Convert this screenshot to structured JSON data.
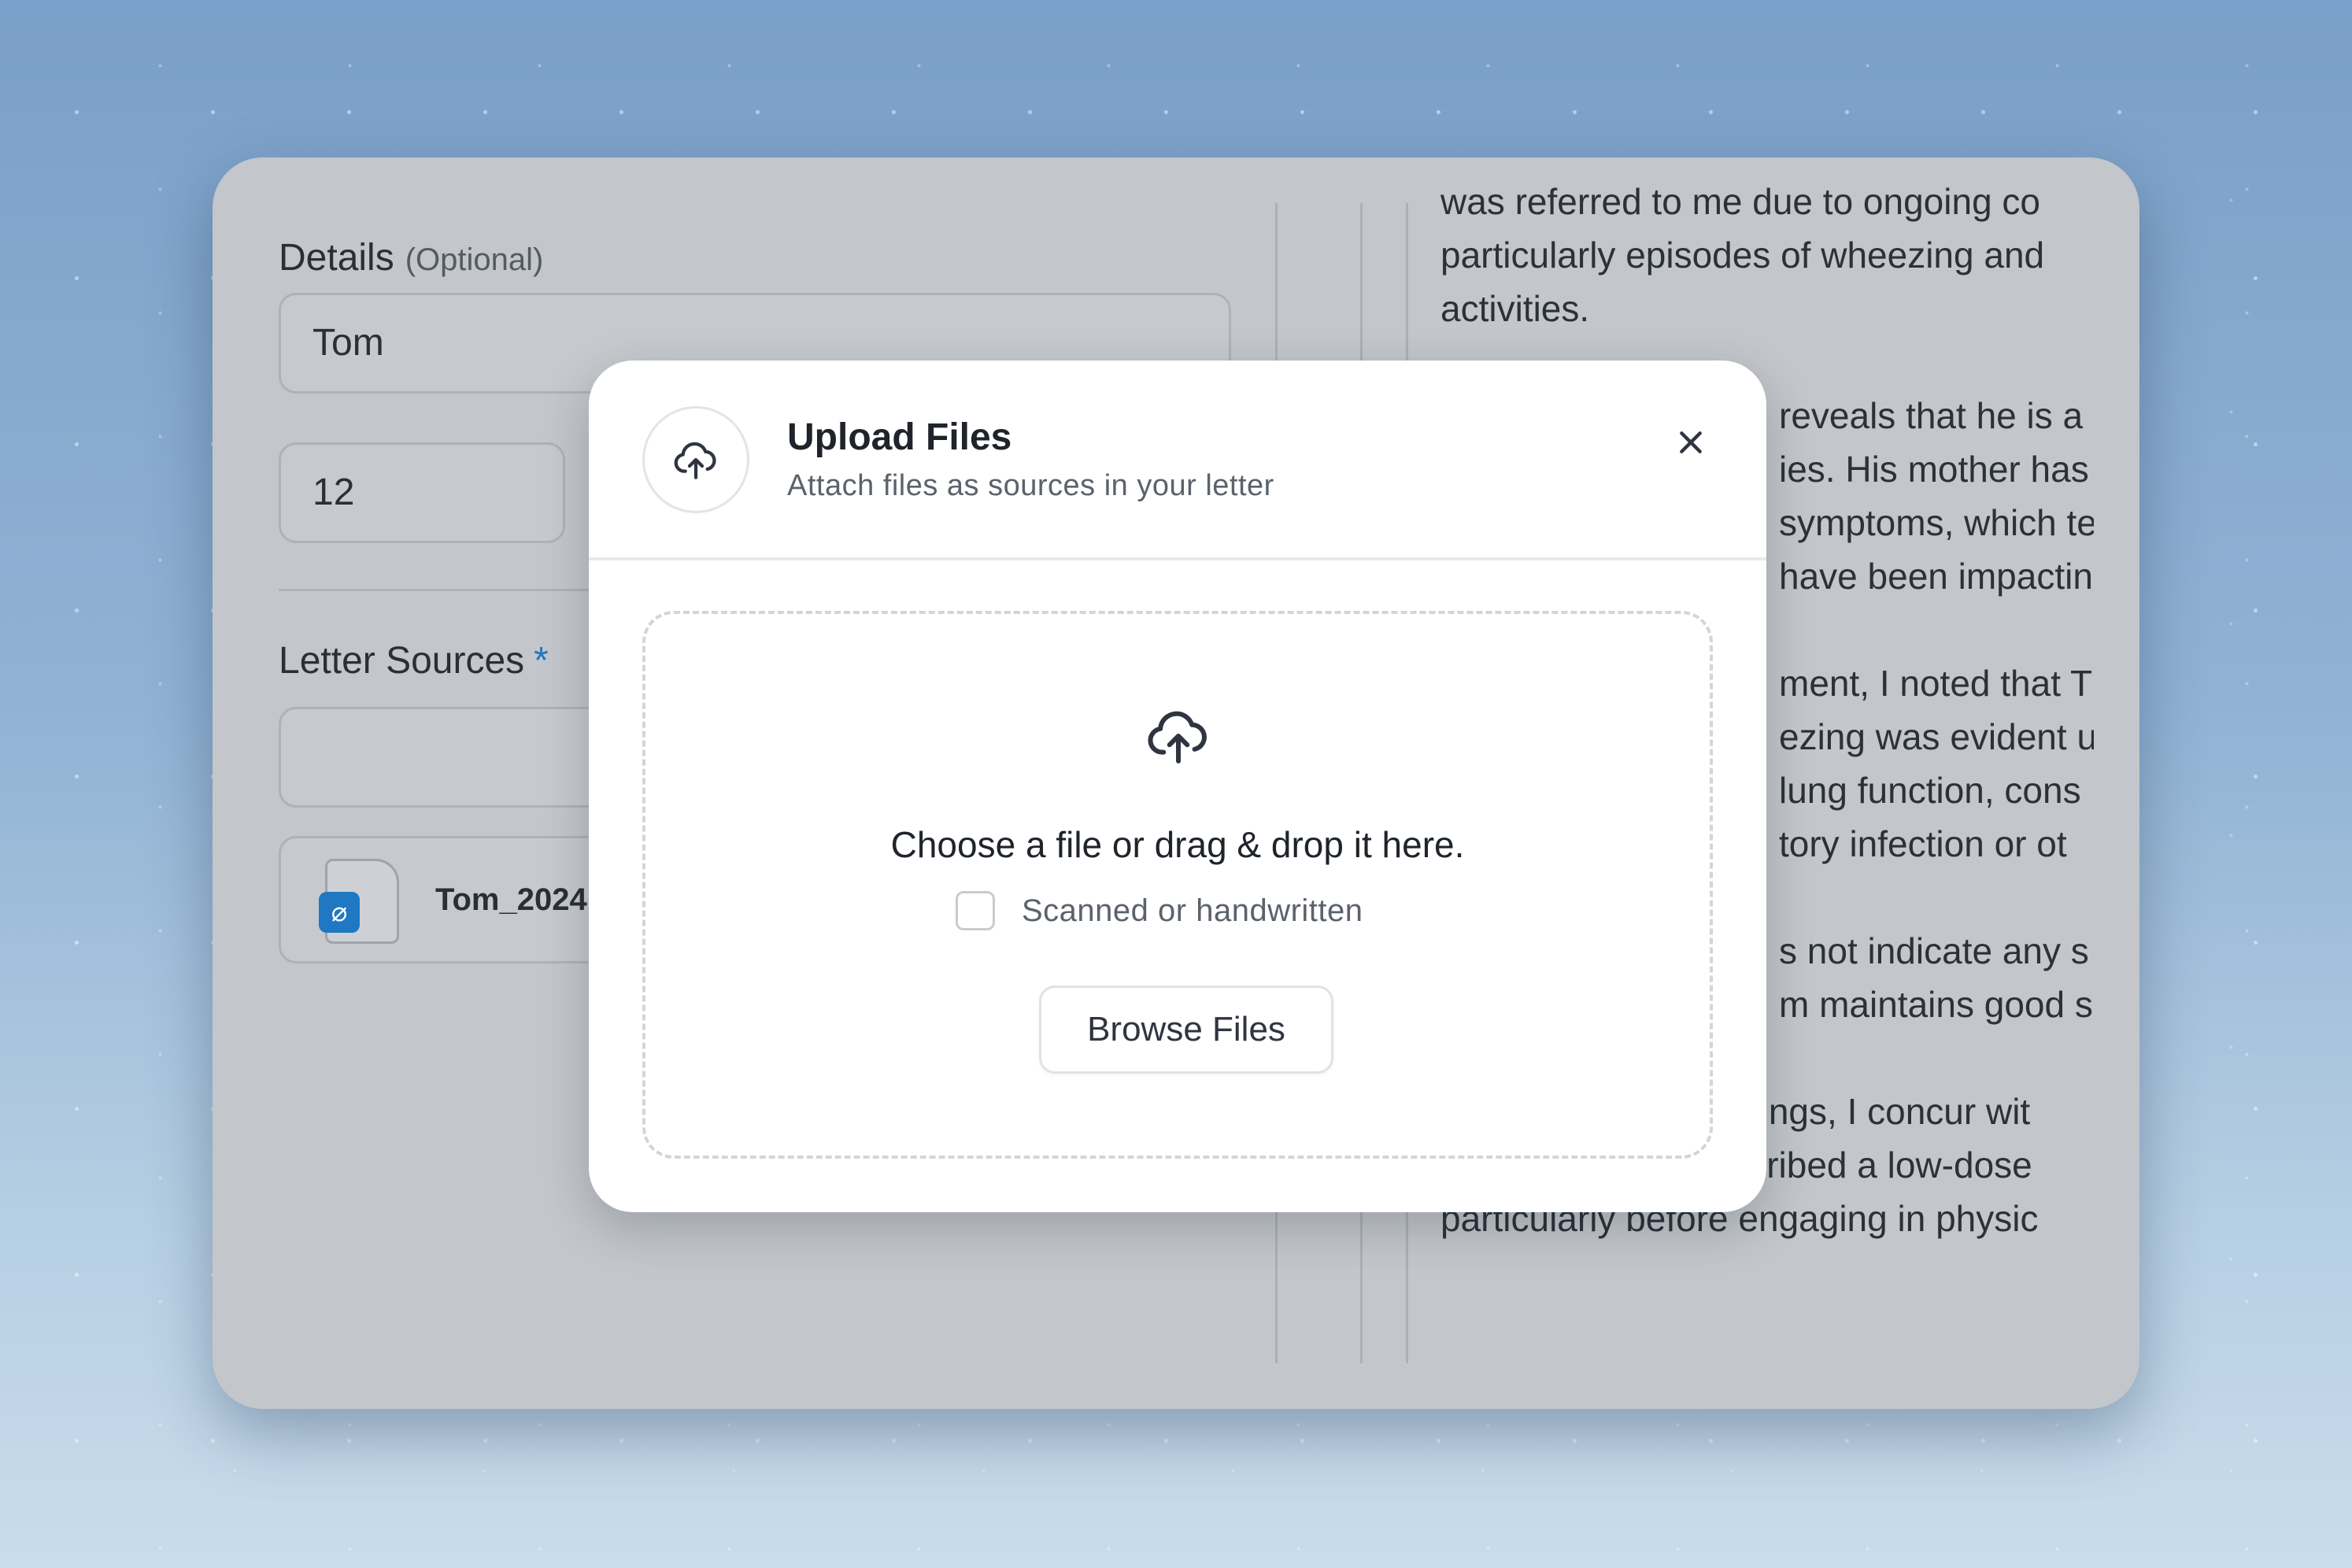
{
  "form": {
    "details_label": "Details",
    "details_optional": "(Optional)",
    "name_value": "Tom",
    "age_value": "12",
    "sources_label": "Letter Sources",
    "required_mark": "*",
    "attached_file_name": "Tom_2024"
  },
  "letter": {
    "paragraphs": [
      [
        "was referred to me due to ongoing co",
        "particularly episodes of wheezing and",
        "activities."
      ],
      [
        "reveals that he is a",
        "ies. His mother has",
        "symptoms, which te",
        "have been impactin"
      ],
      [
        "ment, I noted that T",
        "ezing was evident u",
        "lung function, cons",
        "tory infection or ot"
      ],
      [
        "s not indicate any s",
        "m maintains good s"
      ],
      [
        "Based on these findings, I concur wit",
        "Tom has been prescribed a low-dose",
        "particularly before engaging in physic"
      ]
    ]
  },
  "modal": {
    "title": "Upload Files",
    "subtitle": "Attach files as sources in your letter",
    "header_icon": "cloud-upload-icon",
    "close_icon": "close-icon",
    "dropzone": {
      "icon": "cloud-upload-icon",
      "title": "Choose a file or drag & drop it here.",
      "checkbox_label": "Scanned or handwritten",
      "checkbox_checked": false,
      "browse_label": "Browse Files"
    }
  },
  "colors": {
    "accent": "#1f78c1",
    "overlay_window": "#c3c6ca"
  }
}
